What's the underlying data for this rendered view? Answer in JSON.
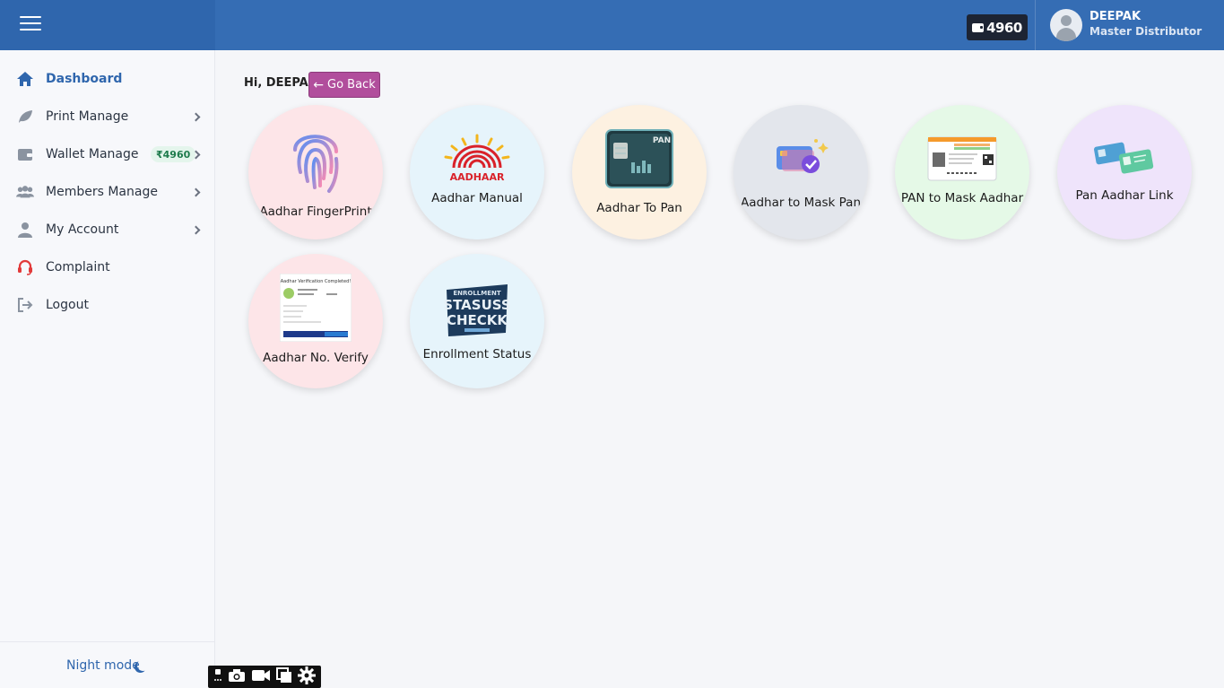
{
  "header": {
    "wallet_balance": "4960",
    "user_name": "DEEPAK",
    "user_role": "Master Distributor"
  },
  "sidebar": {
    "items": [
      {
        "label": "Dashboard",
        "icon": "home-icon"
      },
      {
        "label": "Print Manage",
        "icon": "leaf-icon"
      },
      {
        "label": "Wallet Manage",
        "icon": "wallet-icon",
        "badge": "₹4960"
      },
      {
        "label": "Members Manage",
        "icon": "users-icon"
      },
      {
        "label": "My Account",
        "icon": "user-icon"
      },
      {
        "label": "Complaint",
        "icon": "headset-icon"
      },
      {
        "label": "Logout",
        "icon": "logout-icon"
      }
    ],
    "night_mode_label": "Night mode"
  },
  "main": {
    "greeting": "Hi, DEEPAK",
    "go_back_label": "Go Back",
    "services": [
      {
        "label": "Aadhar FingerPrint",
        "color": "#fde5e8"
      },
      {
        "label": "Aadhar Manual",
        "color": "#e6f4fb"
      },
      {
        "label": "Aadhar To Pan",
        "color": "#fdf1e1"
      },
      {
        "label": "Aadhar to Mask Pan",
        "color": "#e3e6ec"
      },
      {
        "label": "PAN to Mask Aadhar",
        "color": "#e5f9e7"
      },
      {
        "label": "Pan Aadhar Link",
        "color": "#efe4fb"
      },
      {
        "label": "Aadhar No. Verify",
        "color": "#fde5e8"
      },
      {
        "label": "Enrollment Status",
        "color": "#e6f4fb"
      }
    ],
    "art_text": {
      "aadhaar_logo": "AADHAAR",
      "pan_card": "PAN",
      "enroll_top": "ENROLLMENT",
      "enroll_1": "STASUSS",
      "enroll_2": "CHECKK",
      "verify_title": "Aadhar Verification Completed!"
    }
  },
  "colors": {
    "topbar": "#356db4",
    "accent": "#2f66ad",
    "go_back": "#b14e9c"
  }
}
